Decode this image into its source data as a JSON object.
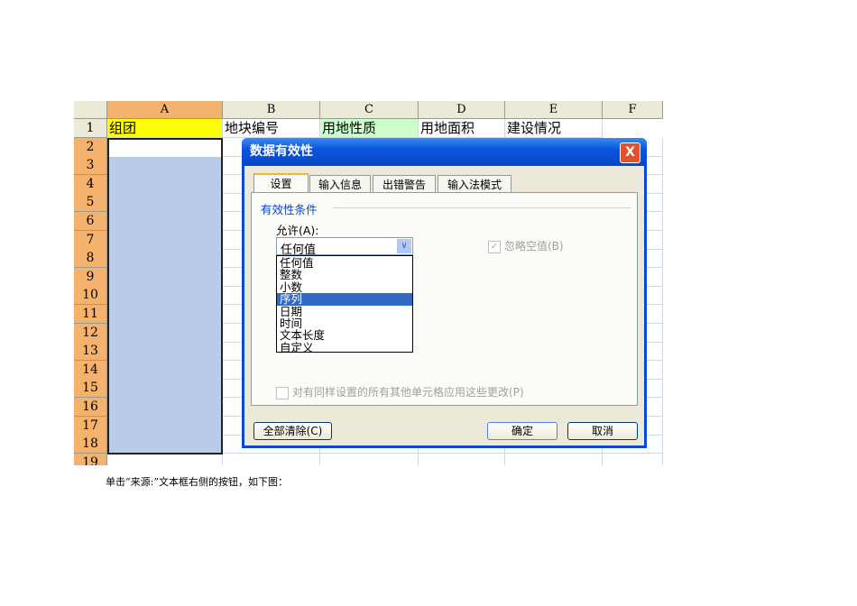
{
  "sheet": {
    "columns": [
      "A",
      "B",
      "C",
      "D",
      "E",
      "F"
    ],
    "rows": [
      "1",
      "2",
      "3",
      "4",
      "5",
      "6",
      "7",
      "8",
      "9",
      "10",
      "11",
      "12",
      "13",
      "14",
      "15",
      "16",
      "17",
      "18",
      "19"
    ],
    "row1": [
      "组团",
      "地块编号",
      "用地性质",
      "用地面积",
      "建设情况",
      ""
    ]
  },
  "dialog": {
    "title": "数据有效性",
    "close": "X",
    "tabs": [
      "设置",
      "输入信息",
      "出错警告",
      "输入法模式"
    ],
    "group_label": "有效性条件",
    "allow_label": "允许(A):",
    "allow_value": "任何值",
    "options": [
      "任何值",
      "整数",
      "小数",
      "序列",
      "日期",
      "时间",
      "文本长度",
      "自定义"
    ],
    "highlighted_option": "序列",
    "ignore_blank": "忽略空值(B)",
    "apply_all": "对有同样设置的所有其他单元格应用这些更改(P)",
    "clear_all": "全部清除(C)",
    "ok": "确定",
    "cancel": "取消"
  },
  "caption": "单击“来源:”文本框右侧的按钮，如下图："
}
